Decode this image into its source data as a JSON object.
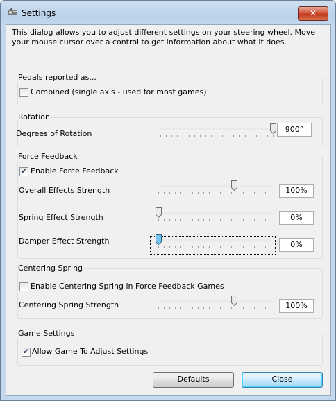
{
  "window": {
    "title": "Settings",
    "close_glyph": "✕"
  },
  "intro_text": "This dialog allows you to adjust different settings on your steering wheel.  Move your mouse cursor over a control to get information about what it does.",
  "pedals": {
    "group_label": "Pedals reported as...",
    "combined_label": "Combined (single axis - used for most games)",
    "combined_checked": false
  },
  "rotation": {
    "group_label": "Rotation",
    "degrees_label": "Degrees of Rotation",
    "degrees_value": "900°",
    "degrees_fraction": 1.0
  },
  "force_feedback": {
    "group_label": "Force Feedback",
    "enable_label": "Enable Force Feedback",
    "enable_checked": true,
    "overall_label": "Overall Effects Strength",
    "overall_value": "100%",
    "overall_fraction": 0.67,
    "spring_label": "Spring Effect Strength",
    "spring_value": "0%",
    "spring_fraction": 0.0,
    "damper_label": "Damper Effect Strength",
    "damper_value": "0%",
    "damper_fraction": 0.0
  },
  "centering": {
    "group_label": "Centering Spring",
    "enable_label": "Enable Centering Spring in Force Feedback Games",
    "enable_checked": false,
    "strength_label": "Centering Spring Strength",
    "strength_value": "100%",
    "strength_fraction": 0.67
  },
  "game_settings": {
    "group_label": "Game Settings",
    "allow_label": "Allow Game To Adjust Settings",
    "allow_checked": true
  },
  "buttons": {
    "defaults_label": "Defaults",
    "close_label": "Close"
  },
  "colors": {
    "title_bar": "#b9d1ea",
    "dialog_bg": "#f0f0f0",
    "close_button": "#c23a1b",
    "thumb_focus": "#74c6f1"
  }
}
